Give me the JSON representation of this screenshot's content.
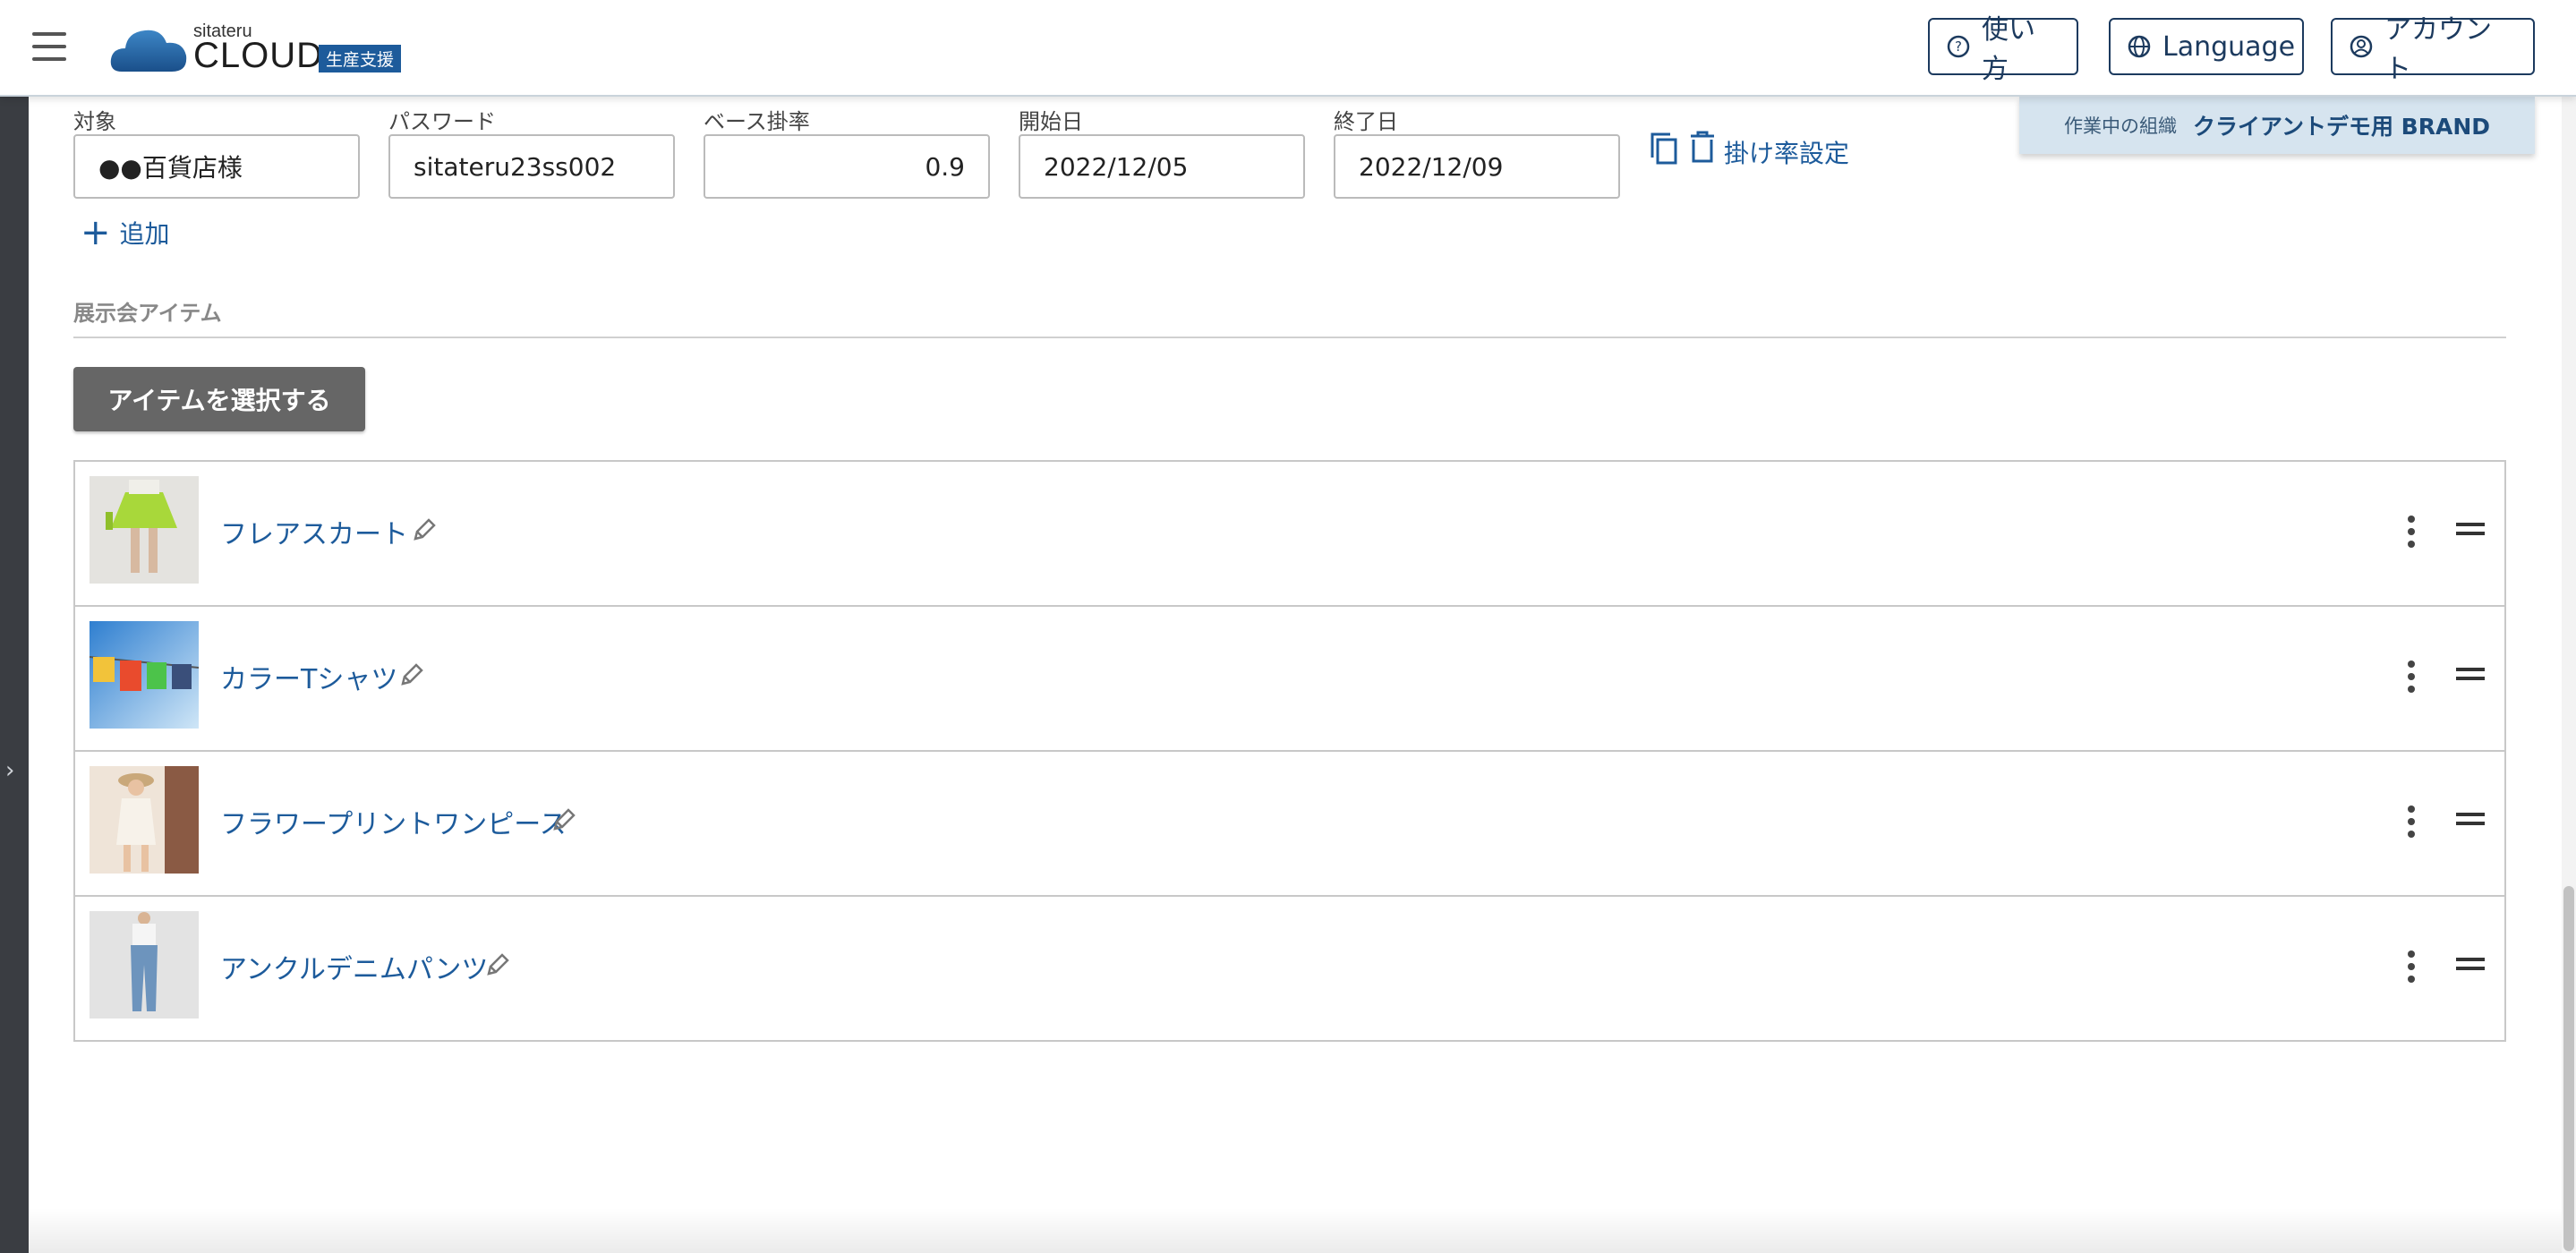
{
  "header": {
    "logo_small": "sitateru",
    "logo_main": "CLOUD",
    "logo_badge": "生産支援",
    "help_label": "使い方",
    "language_label": "Language",
    "account_label": "アカウント"
  },
  "org_banner": {
    "label": "作業中の組織",
    "name": "クライアントデモ用 BRAND"
  },
  "form": {
    "fields": [
      {
        "label": "対象",
        "value": "●●百貨店様"
      },
      {
        "label": "パスワード",
        "value": "sitateru23ss002"
      },
      {
        "label": "ベース掛率",
        "value": "0.9"
      },
      {
        "label": "開始日",
        "value": "2022/12/05"
      },
      {
        "label": "終了日",
        "value": "2022/12/09"
      }
    ],
    "rate_setting_label": "掛け率設定",
    "add_label": "追加"
  },
  "section": {
    "title": "展示会アイテム",
    "select_button": "アイテムを選択する"
  },
  "items": [
    {
      "name": "フレアスカート",
      "thumb_icon": "skirt-photo"
    },
    {
      "name": "カラーTシャツ",
      "thumb_icon": "tshirts-photo"
    },
    {
      "name": "フラワープリントワンピース",
      "thumb_icon": "dress-photo"
    },
    {
      "name": "アンクルデニムパンツ",
      "thumb_icon": "denim-photo"
    }
  ],
  "colors": {
    "accent": "#1d5b9b",
    "header_border": "#1c3a5e",
    "banner_bg": "#d6e4ef",
    "select_button_bg": "#666666"
  }
}
